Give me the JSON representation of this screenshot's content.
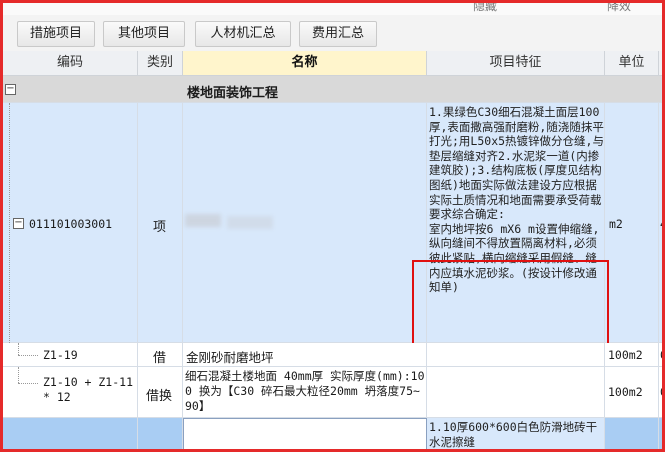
{
  "top_strip": {
    "ghost_left": "隐藏",
    "ghost_right": "降效"
  },
  "tabs": [
    "措施项目",
    "其他项目",
    "人材机汇总",
    "费用汇总"
  ],
  "columns": {
    "code": "编码",
    "category": "类别",
    "name": "名称",
    "feature": "项目特征",
    "unit": "单位"
  },
  "section": {
    "toggle": "−",
    "name": "楼地面装饰工程"
  },
  "item": {
    "toggle": "−",
    "code": "011101003001",
    "category": "项",
    "unit": "m2",
    "extra": "4",
    "feature_text": "1.果绿色C30细石混凝土面层100厚,表面撒高强耐磨粉,随浇随抹平打光;用L50x5热镀锌做分仓缝,与垫层缩缝对齐2.水泥浆一道(内掺建筑胶);3.结构底板(厚度见结构图纸)地面实际做法建设方应根据实际土质情况和地面需要承受荷载要求综合确定:",
    "feature_highlight": "室内地坪按6 mX6 m设置伸缩缝,纵向缝间不得放置隔离材料,必须彼此紧贴,横向缩缝采用假缝、缝内应填水泥砂浆。(按设计修改通知单)"
  },
  "sub_rows": [
    {
      "code": "Z1-19",
      "category": "借",
      "name": "金刚砂耐磨地坪",
      "unit": "100m2",
      "extra": "0"
    },
    {
      "code": "Z1-10 + Z1-11 * 12",
      "category": "借换",
      "name": "细石混凝土楼地面 40mm厚  实际厚度(mm):100  换为【C30 碎石最大粒径20mm 坍落度75~90】",
      "unit": "100m2",
      "extra": "0"
    }
  ],
  "next_item": {
    "feature_text": "1.10厚600*600白色防滑地砖干水泥擦缝"
  }
}
